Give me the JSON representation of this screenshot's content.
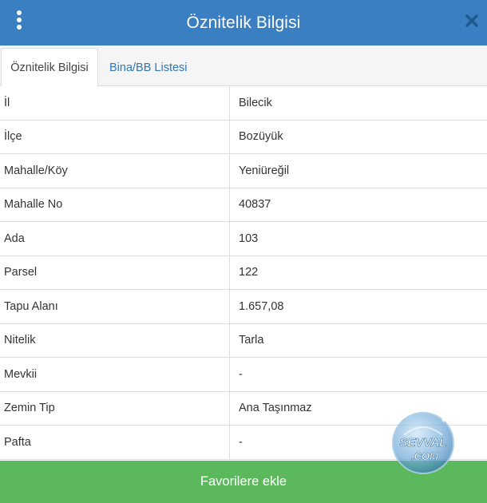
{
  "header": {
    "title": "Öznitelik Bilgisi",
    "menu_icon": "vertical-dots-icon",
    "close_icon": "close-icon",
    "color": "#3a7fc1"
  },
  "tabs": [
    {
      "label": "Öznitelik Bilgisi",
      "active": true
    },
    {
      "label": "Bina/BB Listesi",
      "active": false
    }
  ],
  "attributes": [
    {
      "key": "İl",
      "value": "Bilecik"
    },
    {
      "key": "İlçe",
      "value": "Bozüyük"
    },
    {
      "key": "Mahalle/Köy",
      "value": "Yeniüreğil"
    },
    {
      "key": "Mahalle No",
      "value": "40837"
    },
    {
      "key": "Ada",
      "value": "103"
    },
    {
      "key": "Parsel",
      "value": "122"
    },
    {
      "key": "Tapu Alanı",
      "value": "1.657,08"
    },
    {
      "key": "Nitelik",
      "value": "Tarla"
    },
    {
      "key": "Mevkii",
      "value": "-"
    },
    {
      "key": "Zemin Tip",
      "value": "Ana Taşınmaz"
    },
    {
      "key": "Pafta",
      "value": "-"
    }
  ],
  "footer": {
    "button_label": "Favorilere ekle",
    "color": "#5cb85c"
  },
  "watermark": {
    "top_text": "SEVVAL",
    "bottom_text": ".COM"
  }
}
